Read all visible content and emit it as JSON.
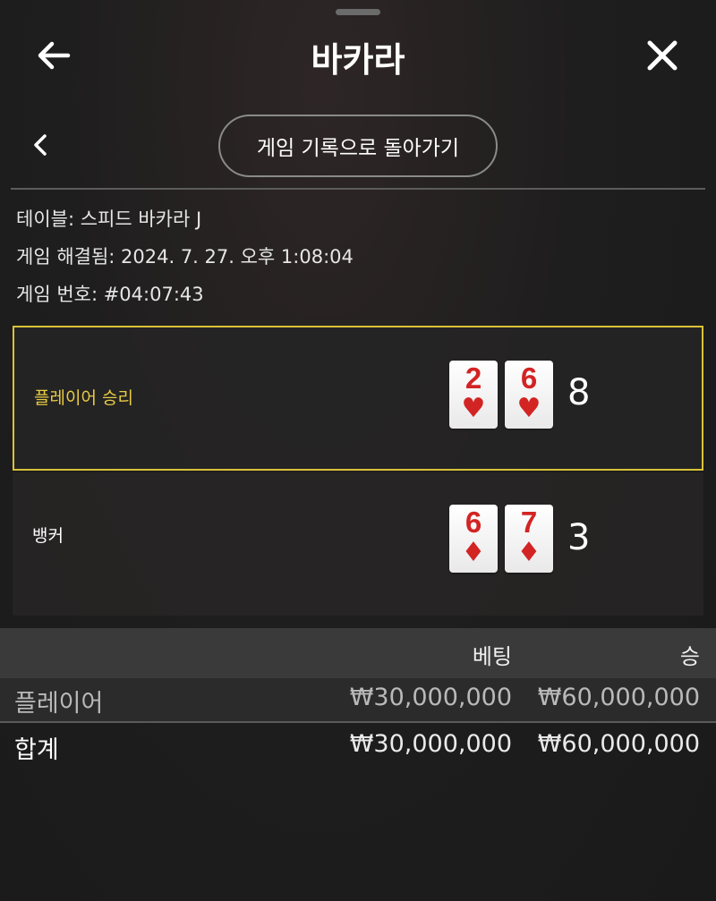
{
  "header": {
    "title": "바카라",
    "back_icon": "arrow-left-icon",
    "close_icon": "close-icon"
  },
  "subnav": {
    "prev_icon": "chevron-left-icon",
    "history_button": "게임 기록으로 돌아가기"
  },
  "info": {
    "table": "테이블: 스피드 바카라 J",
    "resolved": "게임 해결됨: 2024. 7. 27. 오후 1:08:04",
    "game_number": "게임 번호: #04:07:43"
  },
  "player": {
    "label": "플레이어 승리",
    "cards": [
      {
        "rank": "2",
        "suit": "♥"
      },
      {
        "rank": "6",
        "suit": "♥"
      }
    ],
    "score": "8"
  },
  "banker": {
    "label": "뱅커",
    "cards": [
      {
        "rank": "6",
        "suit": "♦"
      },
      {
        "rank": "7",
        "suit": "♦"
      }
    ],
    "score": "3"
  },
  "bets": {
    "columns": {
      "bet": "베팅",
      "win": "승"
    },
    "rows": [
      {
        "name": "플레이어",
        "bet": "₩30,000,000",
        "win": "₩60,000,000"
      }
    ],
    "total": {
      "name": "합계",
      "bet": "₩30,000,000",
      "win": "₩60,000,000"
    }
  },
  "colors": {
    "winner_accent": "#d9c238",
    "card_red": "#d32424"
  }
}
